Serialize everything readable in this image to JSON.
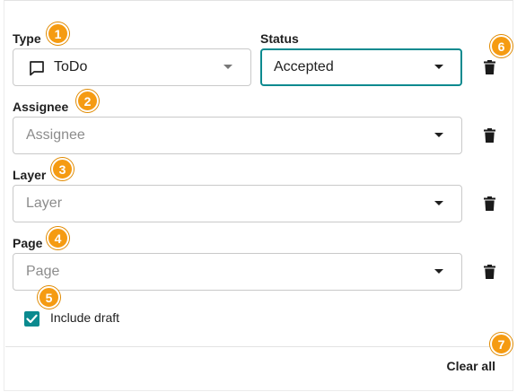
{
  "filters": {
    "type": {
      "label": "Type",
      "value": "ToDo",
      "icon": "comment-icon"
    },
    "status": {
      "label": "Status",
      "value": "Accepted"
    },
    "assignee": {
      "label": "Assignee",
      "placeholder": "Assignee"
    },
    "layer": {
      "label": "Layer",
      "placeholder": "Layer"
    },
    "page": {
      "label": "Page",
      "placeholder": "Page"
    },
    "include_draft": {
      "label": "Include draft",
      "checked": true
    }
  },
  "actions": {
    "clear_all_label": "Clear all"
  },
  "badges": [
    "1",
    "2",
    "3",
    "4",
    "5",
    "6",
    "7"
  ],
  "colors": {
    "accent": "#0b8a8f",
    "badge": "#f59b12"
  }
}
